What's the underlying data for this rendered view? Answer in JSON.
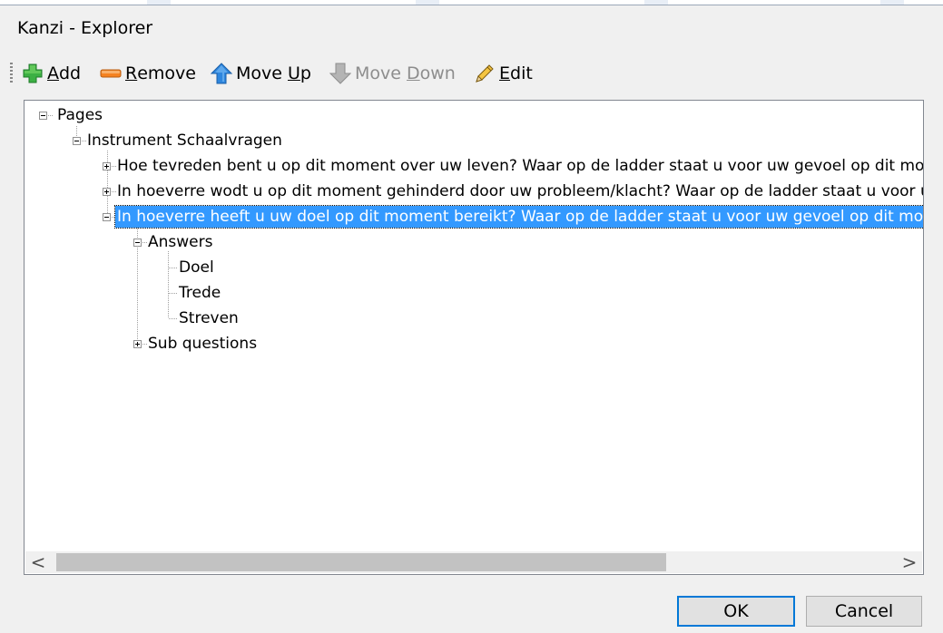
{
  "window": {
    "title": "Kanzi - Explorer"
  },
  "toolbar": {
    "add": {
      "accel": "A",
      "rest": "dd"
    },
    "remove": {
      "accel": "R",
      "rest": "emove"
    },
    "move_up": {
      "pre": "Move ",
      "accel": "U",
      "rest": "p"
    },
    "move_down": {
      "pre": "Move ",
      "accel": "D",
      "rest": "own"
    },
    "edit": {
      "accel": "E",
      "rest": "dit"
    }
  },
  "tree": {
    "root": "Pages",
    "instrument": "Instrument Schaalvragen",
    "questions": [
      "Hoe tevreden bent u op dit moment over uw leven? Waar op de ladder staat u voor uw gevoel op dit mome",
      "In hoeverre wodt u op dit moment gehinderd door uw probleem/klacht? Waar op de ladder staat u voor uw",
      "In hoeverre heeft u uw doel op dit moment bereikt? Waar op de ladder staat u voor uw gevoel op dit mome"
    ],
    "answers_label": "Answers",
    "answers": [
      "Doel",
      "Trede",
      "Streven"
    ],
    "sub_questions_label": "Sub questions"
  },
  "scrollbar": {
    "left": "<",
    "right": ">"
  },
  "buttons": {
    "ok": "OK",
    "cancel": "Cancel"
  },
  "colors": {
    "selection": "#3399ff",
    "default_border": "#0078d7",
    "add_icon": "#3cb043",
    "remove_icon": "#f58220",
    "up_icon": "#2e86de"
  },
  "icons": [
    "add-icon",
    "remove-icon",
    "arrow-up-icon",
    "arrow-down-icon",
    "pencil-icon"
  ]
}
